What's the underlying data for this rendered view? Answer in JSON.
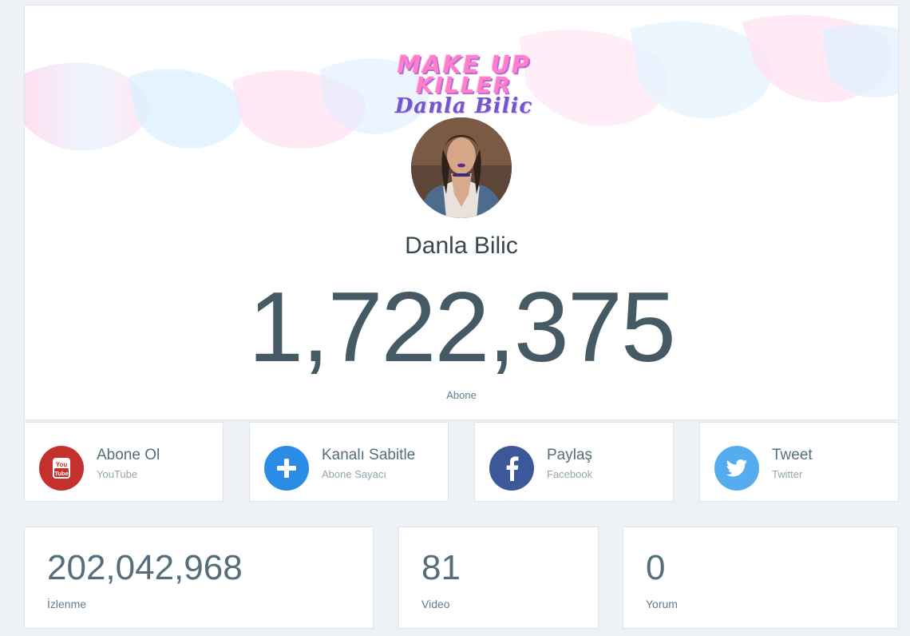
{
  "banner": {
    "logo_line1": "MAKE UP",
    "logo_line2": "KILLER",
    "logo_line3": "Danla Bilic"
  },
  "channel": {
    "name": "Danla Bilic",
    "subscriber_count": "1,722,375",
    "subscriber_label": "Abone"
  },
  "actions": [
    {
      "title": "Abone Ol",
      "subtitle": "YouTube",
      "icon": "youtube-icon",
      "color": "#c4302b"
    },
    {
      "title": "Kanalı Sabitle",
      "subtitle": "Abone Sayacı",
      "icon": "plus-icon",
      "color": "#2b8ce6"
    },
    {
      "title": "Paylaş",
      "subtitle": "Facebook",
      "icon": "facebook-icon",
      "color": "#3b5998"
    },
    {
      "title": "Tweet",
      "subtitle": "Twitter",
      "icon": "twitter-icon",
      "color": "#55acee"
    }
  ],
  "youtube_icon_text": {
    "line1": "You",
    "line2": "Tube"
  },
  "stats": [
    {
      "value": "202,042,968",
      "label": "İzlenme"
    },
    {
      "value": "81",
      "label": "Video"
    },
    {
      "value": "0",
      "label": "Yorum"
    }
  ]
}
